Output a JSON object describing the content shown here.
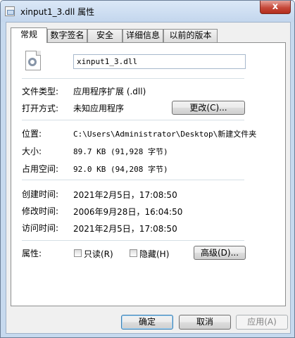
{
  "window": {
    "title": "xinput1_3.dll 属性",
    "close_symbol": "x"
  },
  "tabs": [
    {
      "label": "常规",
      "active": true
    },
    {
      "label": "数字签名",
      "active": false
    },
    {
      "label": "安全",
      "active": false
    },
    {
      "label": "详细信息",
      "active": false
    },
    {
      "label": "以前的版本",
      "active": false
    }
  ],
  "general": {
    "file_name": "xinput1_3.dll",
    "file_type_label": "文件类型:",
    "file_type_value": "应用程序扩展 (.dll)",
    "open_with_label": "打开方式:",
    "open_with_value": "未知应用程序",
    "change_button": "更改(C)...",
    "location_label": "位置:",
    "location_value": "C:\\Users\\Administrator\\Desktop\\新建文件夹",
    "size_label": "大小:",
    "size_value": "89.7 KB (91,928 字节)",
    "size_on_disk_label": "占用空间:",
    "size_on_disk_value": "92.0 KB (94,208 字节)",
    "created_label": "创建时间:",
    "created_value": "2021年2月5日，17:08:50",
    "modified_label": "修改时间:",
    "modified_value": "2006年9月28日，16:04:50",
    "accessed_label": "访问时间:",
    "accessed_value": "2021年2月5日，17:08:50",
    "attributes_label": "属性:",
    "readonly_label": "只读(R)",
    "readonly_checked": false,
    "hidden_label": "隐藏(H)",
    "hidden_checked": false,
    "advanced_button": "高级(D)..."
  },
  "footer": {
    "ok": "确定",
    "cancel": "取消",
    "apply": "应用(A)"
  }
}
